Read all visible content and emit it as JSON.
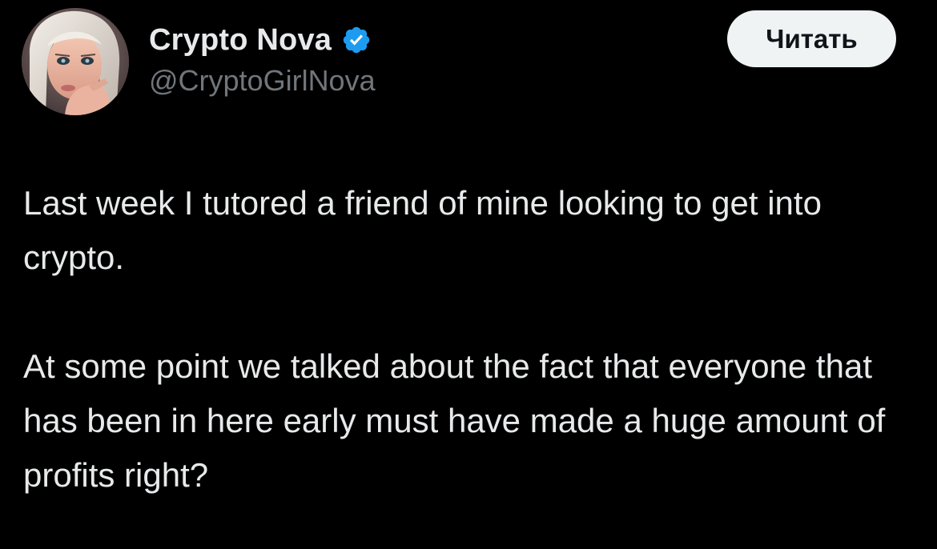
{
  "author": {
    "display_name": "Crypto Nova",
    "handle": "@CryptoGirlNova",
    "verified": true,
    "avatar_icon": "avatar-image",
    "verified_icon": "verified-badge-icon",
    "verified_color": "#1d9bf0"
  },
  "actions": {
    "read_label": "Читать"
  },
  "tweet": {
    "paragraphs": [
      "Last week I tutored a friend of mine looking to get into crypto.",
      "At some point we talked about the fact that everyone that has been in here early must have made a huge amount of profits right?"
    ]
  },
  "colors": {
    "background": "#000000",
    "primary_text": "#e7e9ea",
    "secondary_text": "#71767b",
    "button_bg": "#eff3f4",
    "button_text": "#0f1419"
  }
}
